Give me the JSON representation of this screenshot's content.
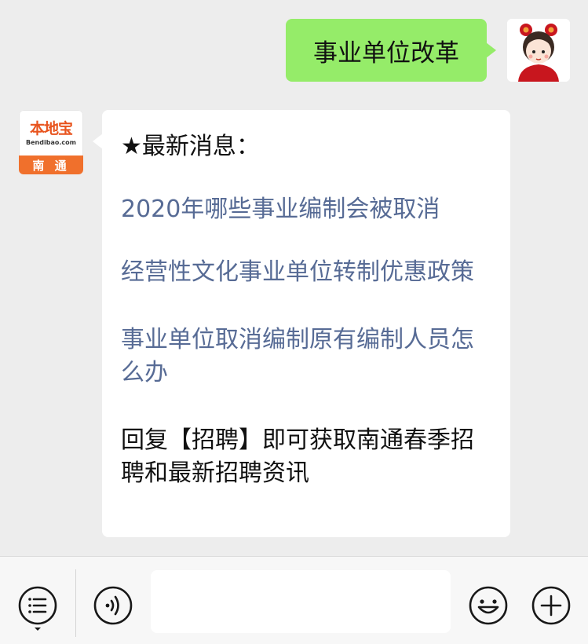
{
  "outgoing": {
    "text": "事业单位改革"
  },
  "bot": {
    "logo_brand": "本地宝",
    "logo_domain": "Bendibao.com",
    "logo_city": "南 通"
  },
  "incoming": {
    "title": "★最新消息：",
    "links": [
      {
        "text": "2020年哪些事业编制会被取消"
      },
      {
        "text": "经营性文化事业单位转制优惠政策"
      },
      {
        "text": "事业单位取消编制原有编制人员怎么办"
      }
    ],
    "footer": "回复【招聘】即可获取南通春季招聘和最新招聘资讯"
  },
  "toolbar": {
    "menu_icon": "menu-list-icon",
    "voice_icon": "voice-icon",
    "emoji_icon": "emoji-icon",
    "plus_icon": "plus-icon",
    "input_value": ""
  }
}
